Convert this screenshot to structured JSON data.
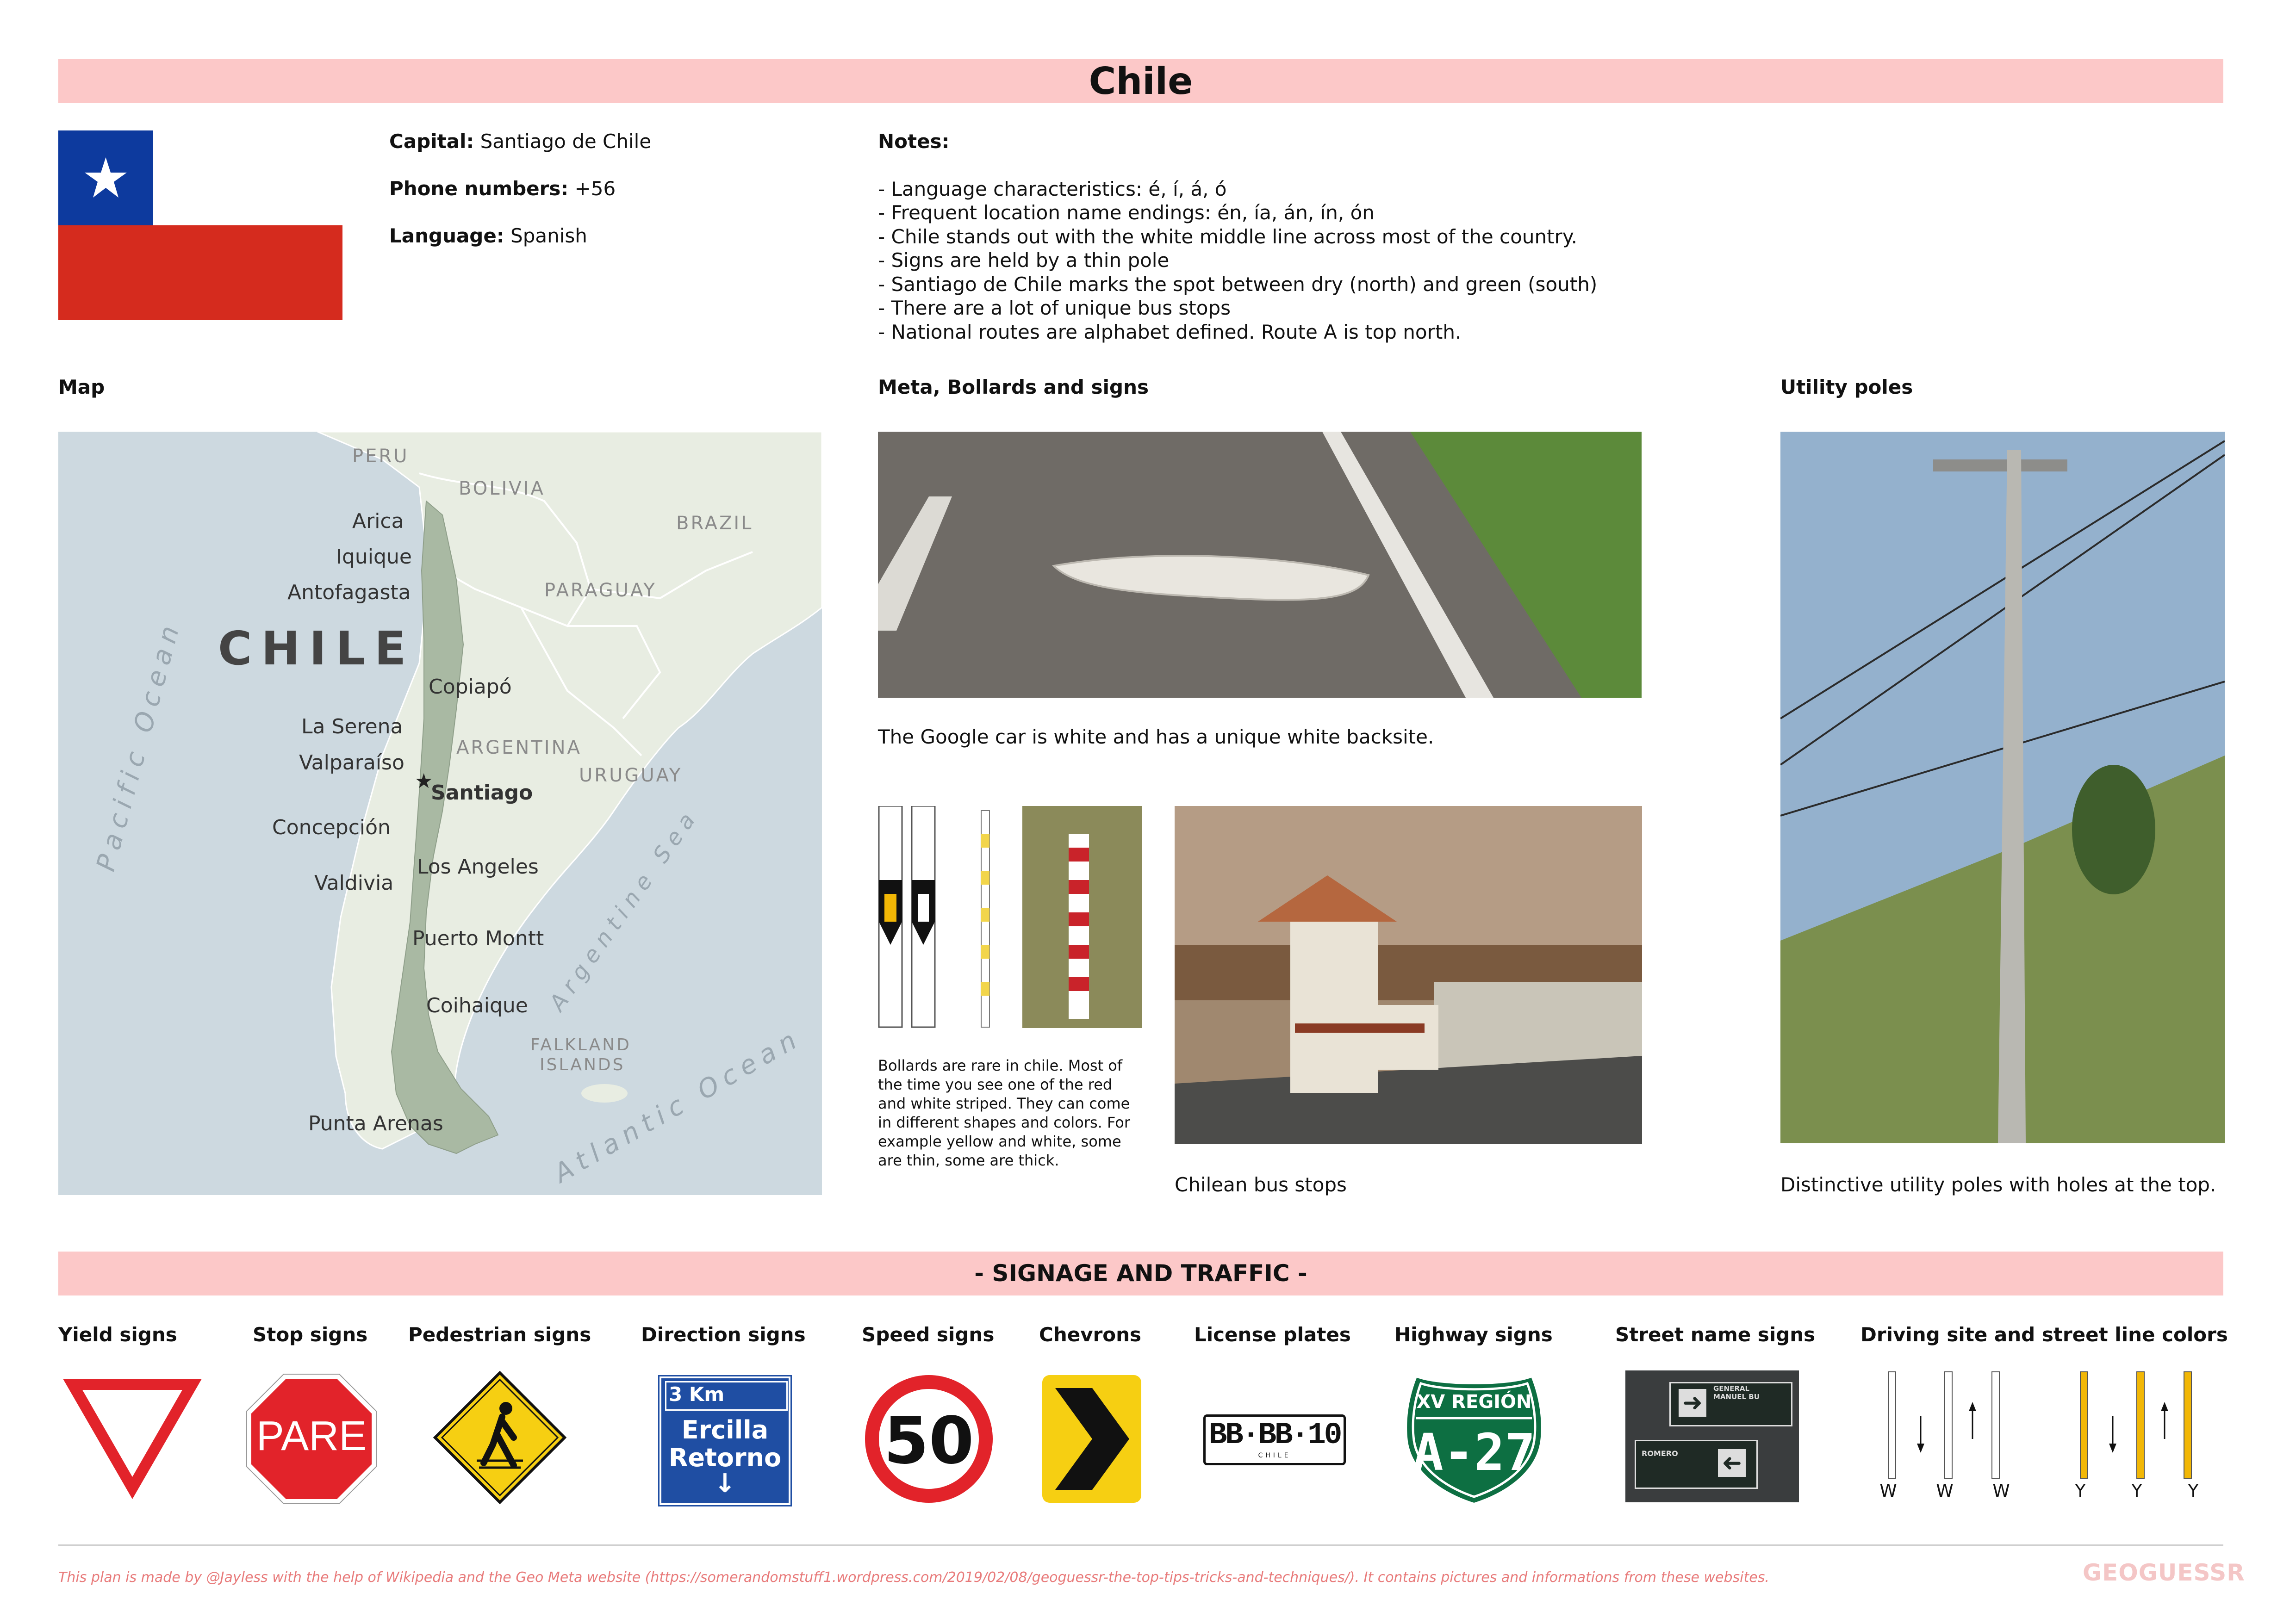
{
  "title": "Chile",
  "info": {
    "capital_label": "Capital:",
    "capital": "Santiago de Chile",
    "phone_label": "Phone numbers:",
    "phone": "+56",
    "language_label": "Language:",
    "language": "Spanish"
  },
  "notes": {
    "heading": "Notes:",
    "items": [
      "- Language characteristics: é, í, á, ó",
      "- Frequent location name endings: én, ía, án, ín, ón",
      "- Chile stands out with the white middle line across most of the country.",
      "- Signs are held by a thin pole",
      "- Santiago de Chile marks the spot between dry (north) and green (south)",
      "- There are a lot of unique bus stops",
      "- National routes are alphabet defined. Route A is top north."
    ]
  },
  "sections": {
    "map": "Map",
    "meta": "Meta, Bollards and signs",
    "poles": "Utility poles"
  },
  "map": {
    "countries": {
      "peru": "PERU",
      "bolivia": "BOLIVIA",
      "brazil": "BRAZIL",
      "paraguay": "PARAGUAY",
      "chile": "CHILE",
      "argentina": "ARGENTINA",
      "uruguay": "URUGUAY",
      "falkland1": "FALKLAND",
      "falkland2": "ISLANDS"
    },
    "cities": {
      "arica": "Arica",
      "iquique": "Iquique",
      "antofagasta": "Antofagasta",
      "copiapo": "Copiapó",
      "laserena": "La Serena",
      "valparaiso": "Valparaíso",
      "santiago": "Santiago",
      "concepcion": "Concepción",
      "losangeles": "Los Angeles",
      "valdivia": "Valdivia",
      "puertomontt": "Puerto Montt",
      "coihaique": "Coihaique",
      "puntaarenas": "Punta Arenas"
    },
    "oceans": {
      "pacific": "Pacific Ocean",
      "atlantic": "Atlantic Ocean",
      "argsea": "Argentine Sea"
    }
  },
  "captions": {
    "google_car": "The Google car is white and has a unique white backsite.",
    "bollards": "Bollards are rare in chile. Most of the time you see one of the red and white striped. They can come in different shapes and colors. For example yellow and white, some are thin, some are thick.",
    "bus_stops": "Chilean bus stops",
    "poles": "Distinctive utility poles with holes at the top."
  },
  "signage": {
    "banner": "- SIGNAGE AND TRAFFIC -",
    "headers": {
      "yield": "Yield signs",
      "stop": "Stop signs",
      "pedestrian": "Pedestrian signs",
      "direction": "Direction signs",
      "speed": "Speed signs",
      "chevrons": "Chevrons",
      "plates": "License plates",
      "highway": "Highway signs",
      "street": "Street name signs",
      "driving": "Driving site and street line colors"
    },
    "stop_text": "PARE",
    "direction": {
      "km": "3 Km",
      "line1": "Ercilla",
      "line2": "Retorno",
      "arrow": "↓"
    },
    "speed": "50",
    "plate": {
      "number": "BB·BB·10",
      "country": "CHILE"
    },
    "highway": {
      "region": "XV REGIÓN",
      "route": "A-27"
    },
    "street": {
      "sign1": "GENERAL MANUEL BU",
      "sign2": "ROMERO"
    },
    "lanes_white": [
      "W",
      "W",
      "W"
    ],
    "lanes_yellow": [
      "Y",
      "Y",
      "Y"
    ]
  },
  "footer": "This plan is made by @Jayless with the help of Wikipedia and the Geo Meta website (https://somerandomstuff1.wordpress.com/2019/02/08/geoguessr-the-top-tips-tricks-and-techniques/). It contains pictures and informations from these websites.",
  "logo": "GEOGUESSR",
  "colors": {
    "banner": "#fcc8c8",
    "flag_blue": "#0d3a9e",
    "flag_red": "#d52b1e",
    "sign_red": "#e2232a",
    "sign_yellow": "#f6cf12",
    "sign_blue": "#1f4ea3",
    "sign_green": "#0d6f42"
  }
}
